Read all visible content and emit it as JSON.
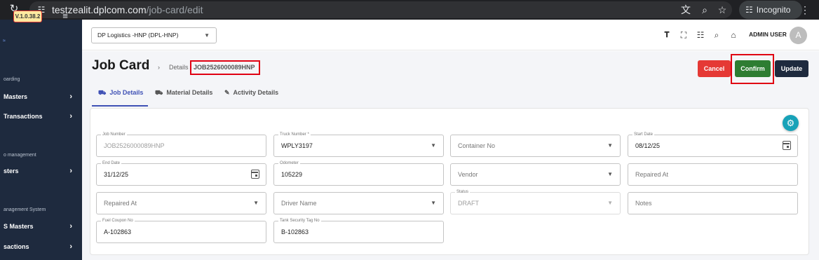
{
  "browser": {
    "url_host": "testzealit.dplcom.com",
    "url_path": "/job-card/edit",
    "incognito_label": "Incognito"
  },
  "sidebar": {
    "version": "V.1.0.38.2",
    "sections": [
      {
        "title": "oarding"
      },
      {
        "title": "o management"
      },
      {
        "title": "anagement System"
      }
    ],
    "items": [
      {
        "label": "Masters"
      },
      {
        "label": "Transactions"
      },
      {
        "label": "sters"
      },
      {
        "label": "S Masters"
      },
      {
        "label": "sactions"
      }
    ]
  },
  "header": {
    "company": "DP Logistics -HNP  (DPL-HNP)",
    "user_name": "ADMIN USER",
    "avatar_initial": "A"
  },
  "page": {
    "title": "Job Card",
    "breadcrumb_label": "Details",
    "breadcrumb_job": "JOB2526000089HNP"
  },
  "actions": {
    "cancel": "Cancel",
    "confirm": "Confirm",
    "update": "Update"
  },
  "tabs": [
    {
      "label": "Job Details",
      "active": true
    },
    {
      "label": "Material Details",
      "active": false
    },
    {
      "label": "Activity Details",
      "active": false
    }
  ],
  "form": {
    "job_number": {
      "label": "Job Number",
      "value": "JOB2526000089HNP"
    },
    "truck_number": {
      "label": "Truck Number *",
      "value": "WPLY3197"
    },
    "container_no": {
      "placeholder": "Container No"
    },
    "start_date": {
      "label": "Start Date",
      "value": "08/12/25"
    },
    "end_date": {
      "label": "End Date",
      "value": "31/12/25"
    },
    "odometer": {
      "label": "Odometer",
      "value": "105229"
    },
    "vendor": {
      "placeholder": "Vendor"
    },
    "repaired_at_text": {
      "placeholder": "Repaired At"
    },
    "repaired_at_select": {
      "placeholder": "Repaired At"
    },
    "driver_name": {
      "placeholder": "Driver Name"
    },
    "status": {
      "label": "Status",
      "value": "DRAFT"
    },
    "notes": {
      "placeholder": "Notes"
    },
    "fuel_coupon_no": {
      "label": "Fuel Coupon No",
      "value": "A-102863"
    },
    "tank_security_tag_no": {
      "label": "Tank Security Tag No",
      "value": "B-102863"
    }
  },
  "colors": {
    "sidebar_bg": "#1e2a3e",
    "accent": "#3f51b5",
    "cancel": "#e53935",
    "confirm": "#2e7d32",
    "update": "#1e2a3e",
    "fab": "#17a2b8",
    "highlight": "#e00012"
  }
}
